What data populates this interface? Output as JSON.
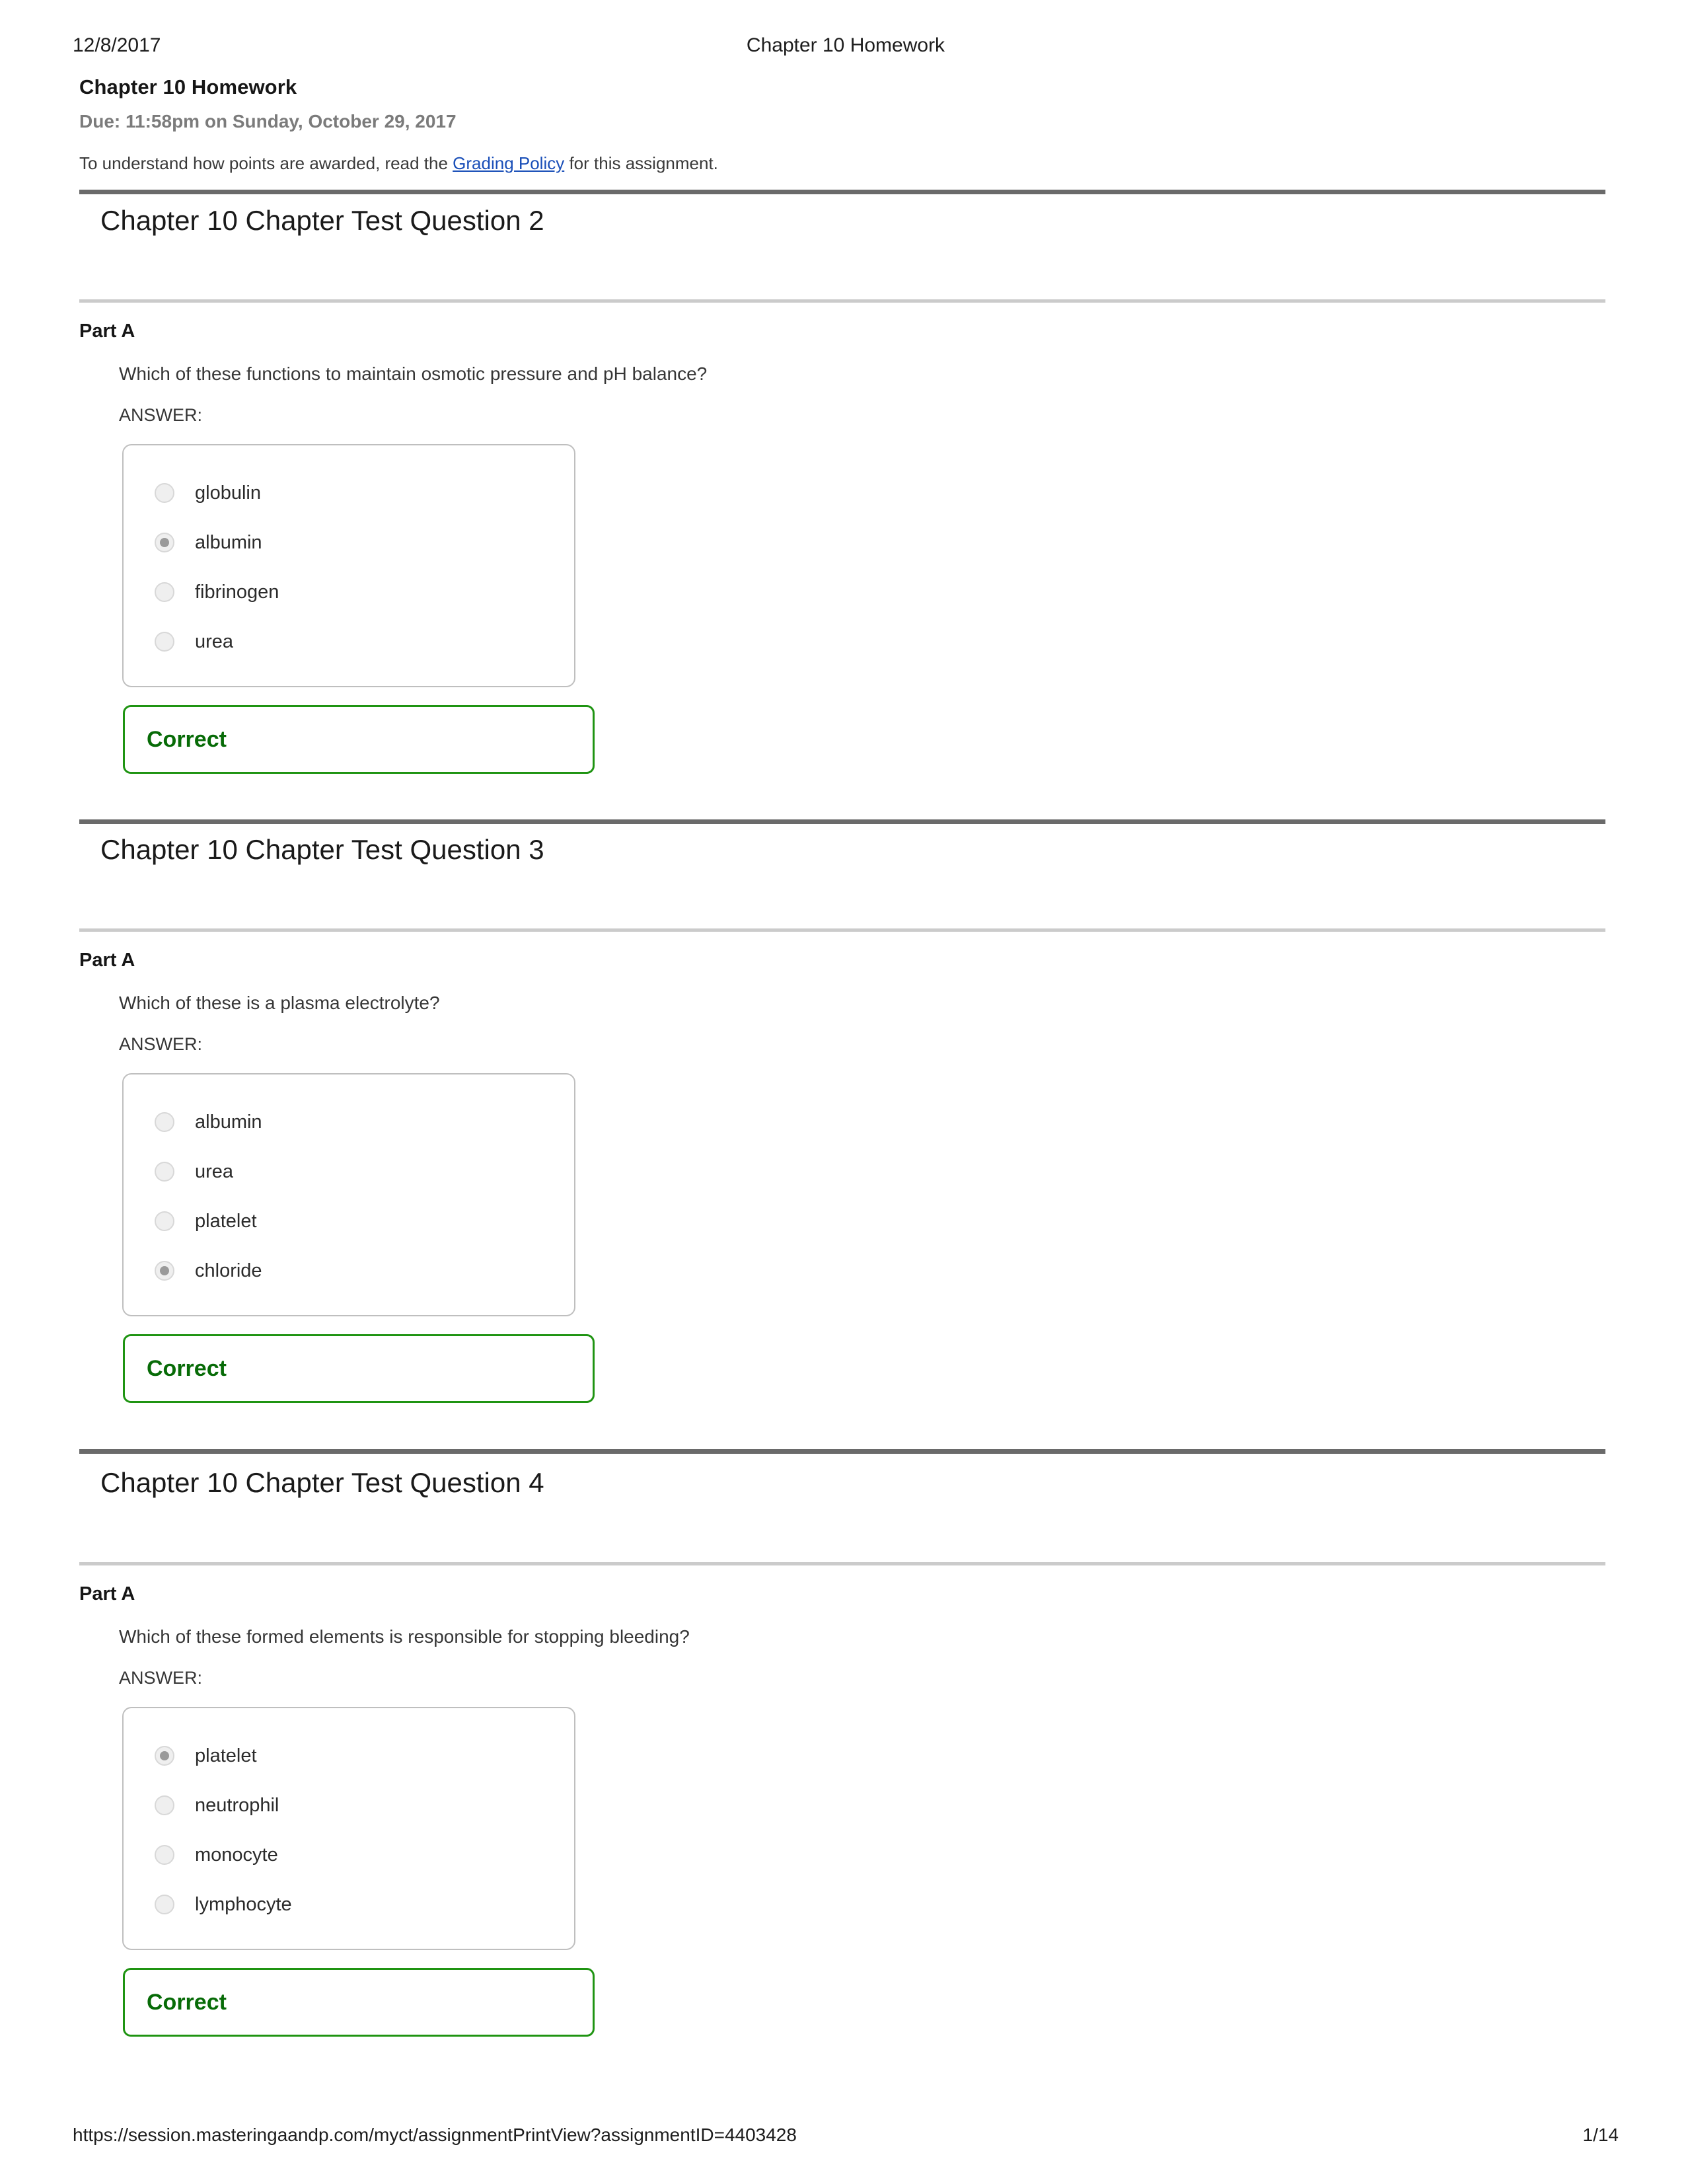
{
  "print_header": {
    "date": "12/8/2017",
    "document_title": "Chapter 10 Homework"
  },
  "masthead": {
    "assignment_title": "Chapter 10 Homework",
    "due_text": "Due: 11:58pm on Sunday, October 29, 2017",
    "note_prefix": "To understand how points are awarded, read the ",
    "note_link": "Grading Policy",
    "note_suffix": " for this assignment."
  },
  "questions": [
    {
      "heading": "Chapter 10 Chapter Test Question 2",
      "part_label": "Part A",
      "question_text": "Which of these functions to maintain osmotic pressure and pH balance?",
      "answer_label": "ANSWER:",
      "options": [
        {
          "label": "globulin",
          "selected": false
        },
        {
          "label": "albumin",
          "selected": true
        },
        {
          "label": "fibrinogen",
          "selected": false
        },
        {
          "label": "urea",
          "selected": false
        }
      ],
      "feedback": "Correct"
    },
    {
      "heading": "Chapter 10 Chapter Test Question 3",
      "part_label": "Part A",
      "question_text": "Which of these is a plasma electrolyte?",
      "answer_label": "ANSWER:",
      "options": [
        {
          "label": "albumin",
          "selected": false
        },
        {
          "label": "urea",
          "selected": false
        },
        {
          "label": "platelet",
          "selected": false
        },
        {
          "label": "chloride",
          "selected": true
        }
      ],
      "feedback": "Correct"
    },
    {
      "heading": "Chapter 10 Chapter Test Question 4",
      "part_label": "Part A",
      "question_text": "Which of these formed elements is responsible for stopping bleeding?",
      "answer_label": "ANSWER:",
      "options": [
        {
          "label": "platelet",
          "selected": true
        },
        {
          "label": "neutrophil",
          "selected": false
        },
        {
          "label": "monocyte",
          "selected": false
        },
        {
          "label": "lymphocyte",
          "selected": false
        }
      ],
      "feedback": "Correct"
    }
  ],
  "print_footer": {
    "url": "https://session.masteringaandp.com/myct/assignmentPrintView?assignmentID=4403428",
    "page": "1/14"
  },
  "colors": {
    "link": "#1a4fb8",
    "correct_border": "#1f9412",
    "correct_text": "#076b07",
    "rule_dark": "#6a6a6a",
    "rule_light": "#cbcbcb",
    "due_text": "#7b7b7b"
  }
}
